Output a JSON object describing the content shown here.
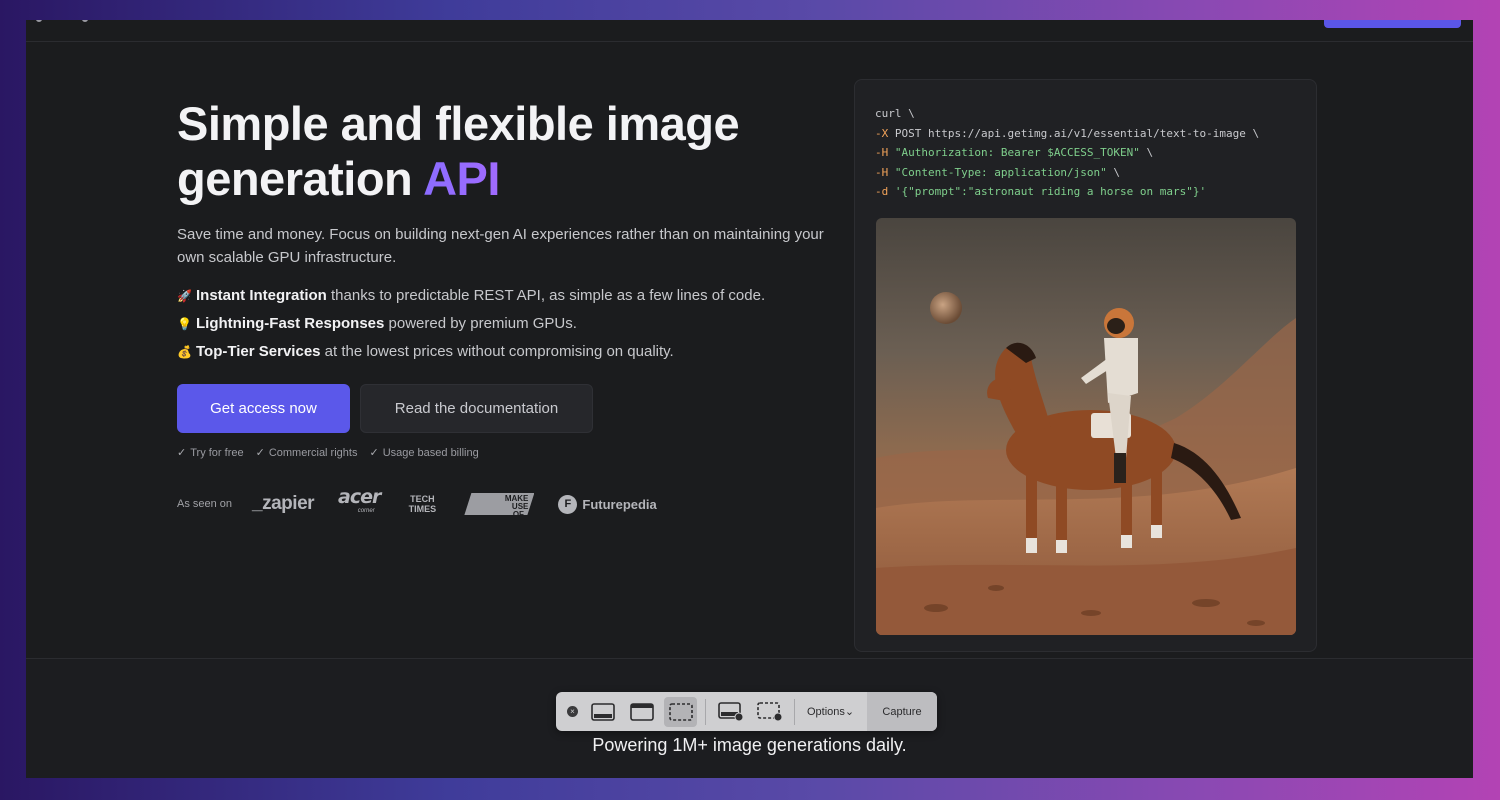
{
  "hero": {
    "title_part1": "Simple and flexible image generation ",
    "title_accent": "API",
    "subtitle": "Save time and money. Focus on building next-gen AI experiences rather than on maintaining your own scalable GPU infrastructure."
  },
  "features": [
    {
      "emoji": "🚀",
      "bold": "Instant Integration",
      "text": " thanks to predictable REST API, as simple as a few lines of code."
    },
    {
      "emoji": "💡",
      "bold": "Lightning-Fast Responses",
      "text": " powered by premium GPUs."
    },
    {
      "emoji": "💰",
      "bold": "Top-Tier Services",
      "text": " at the lowest prices without compromising on quality."
    }
  ],
  "buttons": {
    "primary": "Get access now",
    "secondary": "Read the documentation"
  },
  "checks": [
    "Try for free",
    "Commercial rights",
    "Usage based billing"
  ],
  "as_seen_on": {
    "label": "As seen on",
    "brands": {
      "zapier": "_zapier",
      "acer": "acer",
      "acer_sub": "corner",
      "tech_line1": "TECH",
      "tech_line2": "TIMES",
      "make_line1": "MAKE",
      "make_line2": "USE",
      "make_line3": "OF_",
      "futurepedia": "Futurepedia",
      "futurepedia_icon": "F"
    }
  },
  "code": {
    "line1": "curl \\",
    "line2_flag": "-X",
    "line2_text": " POST https://api.getimg.ai/v1/essential/text-to-image \\",
    "line3_flag": "-H",
    "line3_str": " \"Authorization: Bearer $ACCESS_TOKEN\"",
    "line3_end": " \\",
    "line4_flag": "-H",
    "line4_str": " \"Content-Type: application/json\"",
    "line4_end": " \\",
    "line5_flag": "-d",
    "line5_str": " '{\"prompt\":\"astronaut riding a horse on mars\"}'"
  },
  "powering": "Powering 1M+ image generations daily.",
  "capture_bar": {
    "close_glyph": "×",
    "options": "Options⌄",
    "capture": "Capture"
  },
  "colors": {
    "accent": "#5b58ea",
    "background": "#1b1c1e",
    "code_string": "#7fcf8c",
    "code_flag": "#f2a35a"
  }
}
